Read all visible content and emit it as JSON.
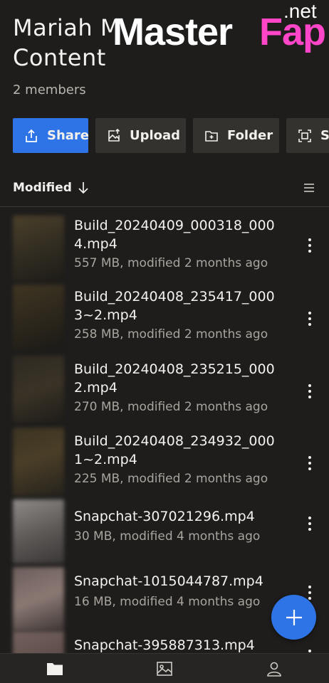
{
  "header": {
    "title": "Mariah M\nContent",
    "members": "2 members"
  },
  "watermark": {
    "master": "Master",
    "fap": "Fap",
    "net": ".net"
  },
  "actions": [
    {
      "label": "Share",
      "icon": "share-icon"
    },
    {
      "label": "Upload",
      "icon": "upload-image-icon"
    },
    {
      "label": "Folder",
      "icon": "new-folder-icon"
    },
    {
      "label": "S",
      "icon": "scan-icon"
    }
  ],
  "sort": {
    "label": "Modified",
    "direction_icon": "arrow-down-icon",
    "view_icon": "list-view-icon"
  },
  "files": [
    {
      "name": "Build_20240409_000318_000\n4.mp4",
      "meta": "557 MB, modified 2 months ago"
    },
    {
      "name": "Build_20240408_235417_000\n3~2.mp4",
      "meta": "258 MB, modified 2 months ago"
    },
    {
      "name": "Build_20240408_235215_000\n2.mp4",
      "meta": "270 MB, modified 2 months ago"
    },
    {
      "name": "Build_20240408_234932_000\n1~2.mp4",
      "meta": "225 MB, modified 2 months ago"
    },
    {
      "name": "Snapchat-307021296.mp4",
      "meta": "30 MB, modified 4 months ago"
    },
    {
      "name": "Snapchat-1015044787.mp4",
      "meta": "16 MB, modified 4 months ago"
    },
    {
      "name": "Snapchat-395887313.mp4",
      "meta": ""
    }
  ],
  "fab": {
    "icon": "plus-icon"
  },
  "bottom_nav": [
    {
      "icon": "folder-icon"
    },
    {
      "icon": "photos-icon"
    },
    {
      "icon": "account-icon"
    }
  ],
  "colors": {
    "accent": "#2f74e6",
    "background": "#1e1d1c",
    "watermark_pink": "#ff45c8"
  }
}
